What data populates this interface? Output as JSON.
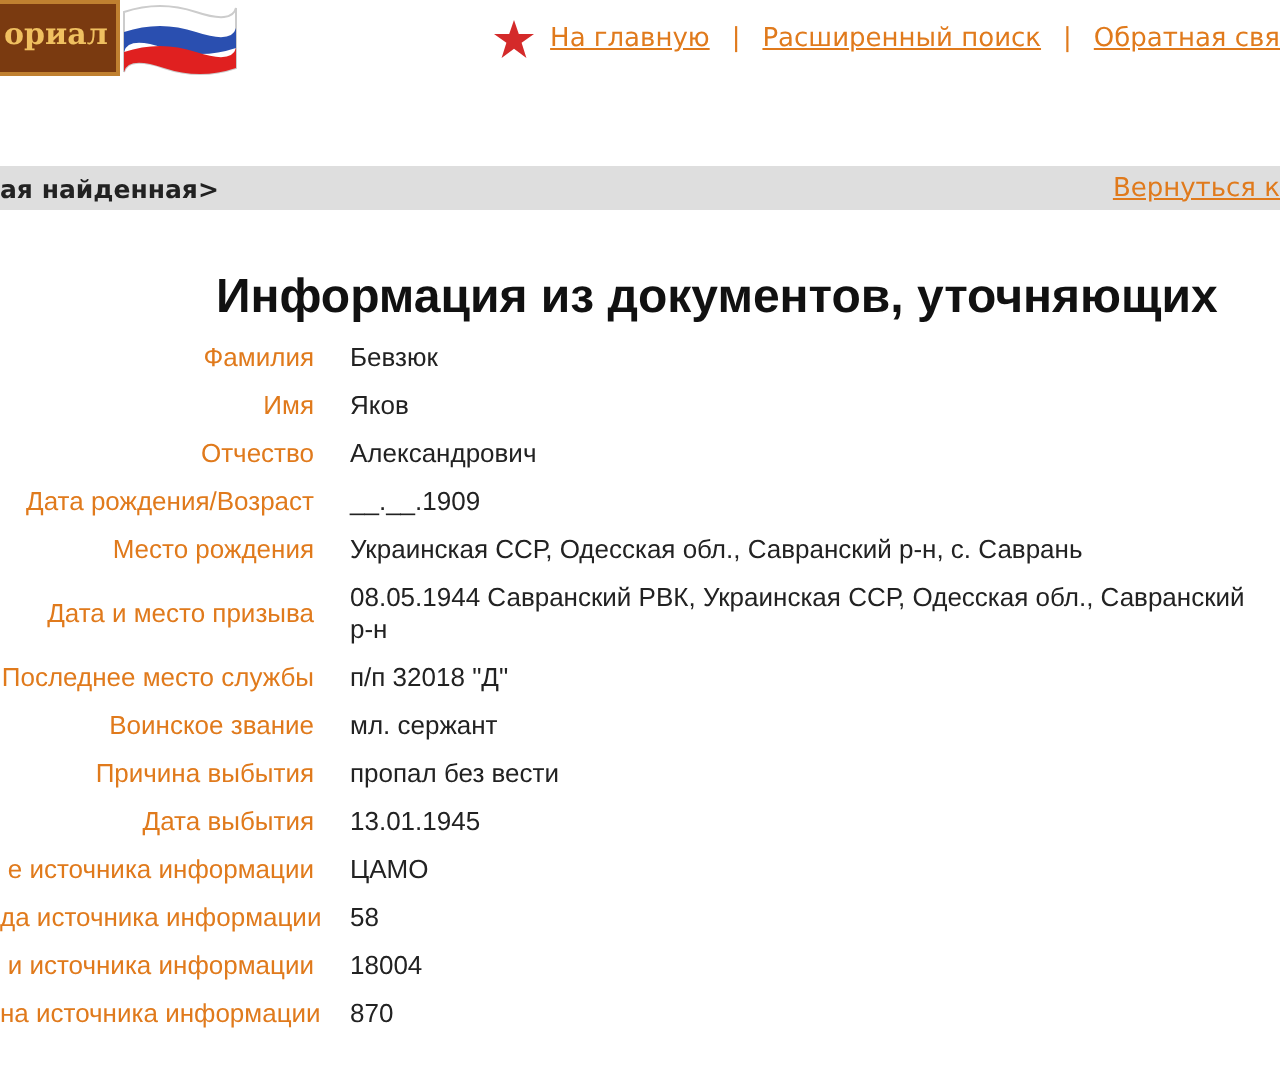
{
  "header": {
    "logo_text": "ориал",
    "nav": [
      {
        "label": "На главную"
      },
      {
        "label": "Расширенный поиск"
      },
      {
        "label": "Обратная свя"
      }
    ],
    "separators": [
      "|",
      "|"
    ]
  },
  "breadcrumb_bar": {
    "path": "ая найденная>",
    "back_link": "Вернуться к"
  },
  "title": "Информация из документов, уточняющих",
  "fields": [
    {
      "label": "Фамилия",
      "value": "Бевзюк"
    },
    {
      "label": "Имя",
      "value": "Яков"
    },
    {
      "label": "Отчество",
      "value": "Александрович"
    },
    {
      "label": "Дата рождения/Возраст",
      "value": "__.__.1909"
    },
    {
      "label": "Место рождения",
      "value": "Украинская ССР, Одесская обл., Савранский р-н, с. Саврань"
    },
    {
      "label": "Дата и место призыва",
      "value": "08.05.1944 Савранский РВК, Украинская ССР, Одесская обл., Савранский р-н"
    },
    {
      "label": "Последнее место службы",
      "value": "п/п 32018 \"Д\""
    },
    {
      "label": "Воинское звание",
      "value": "мл. сержант"
    },
    {
      "label": "Причина выбытия",
      "value": "пропал без вести"
    },
    {
      "label": "Дата выбытия",
      "value": "13.01.1945"
    },
    {
      "label": "е источника информации",
      "value": "ЦАМО"
    },
    {
      "label": "да источника информации",
      "value": "58"
    },
    {
      "label": "и источника информации",
      "value": "18004"
    },
    {
      "label": "на источника информации",
      "value": "870"
    }
  ]
}
